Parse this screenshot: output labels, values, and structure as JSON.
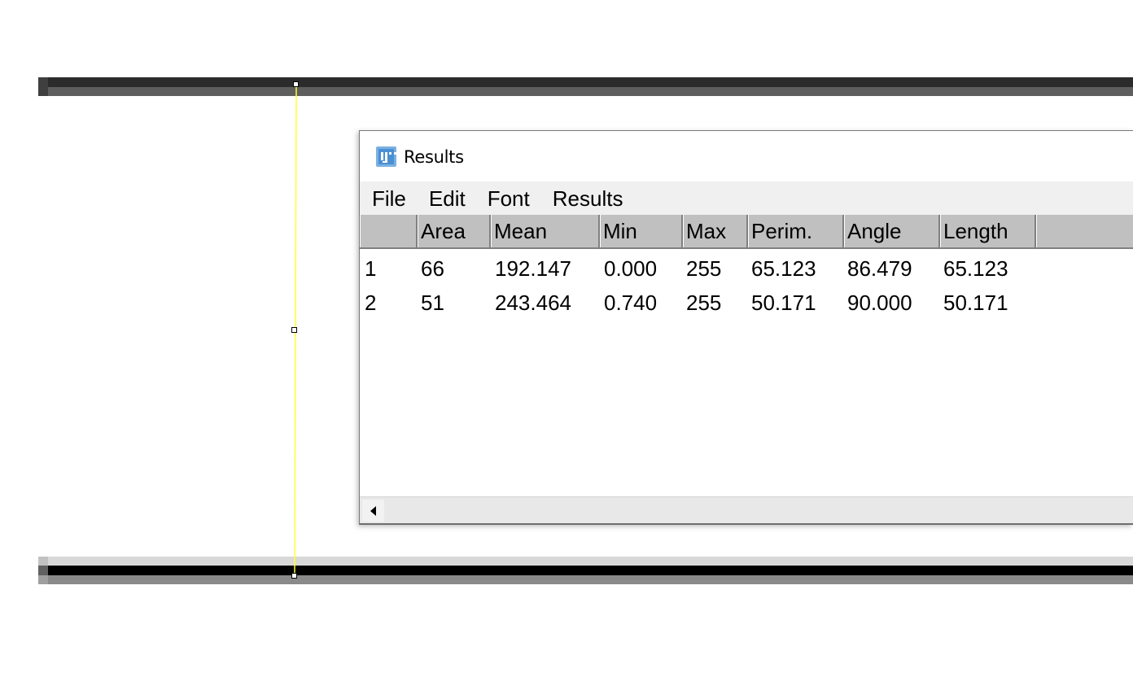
{
  "window": {
    "title": "Results",
    "icon": "imagej-icon"
  },
  "menu": [
    "File",
    "Edit",
    "Font",
    "Results"
  ],
  "table": {
    "headers": [
      "",
      "Area",
      "Mean",
      "Min",
      "Max",
      "Perim.",
      "Angle",
      "Length"
    ],
    "rows": [
      [
        "1",
        "66",
        "192.147",
        "0.000",
        "255",
        "65.123",
        "86.479",
        "65.123"
      ],
      [
        "2",
        "51",
        "243.464",
        "0.740",
        "255",
        "50.171",
        "90.000",
        "50.171"
      ]
    ]
  },
  "scrollbar": {
    "left_arrow_icon": "triangle-left-icon"
  },
  "canvas": {
    "roi_color": "#ffff33"
  }
}
